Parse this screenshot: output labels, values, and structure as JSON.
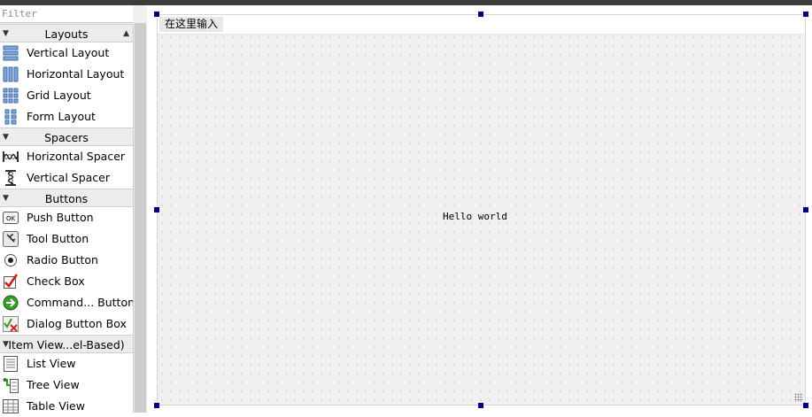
{
  "widget_box": {
    "filter_placeholder": "Filter",
    "categories": [
      {
        "title": "Layouts",
        "items": [
          {
            "label": "Vertical Layout",
            "icon": "vertical-layout-icon"
          },
          {
            "label": "Horizontal Layout",
            "icon": "horizontal-layout-icon"
          },
          {
            "label": "Grid Layout",
            "icon": "grid-layout-icon"
          },
          {
            "label": "Form Layout",
            "icon": "form-layout-icon"
          }
        ]
      },
      {
        "title": "Spacers",
        "items": [
          {
            "label": "Horizontal Spacer",
            "icon": "horizontal-spacer-icon"
          },
          {
            "label": "Vertical Spacer",
            "icon": "vertical-spacer-icon"
          }
        ]
      },
      {
        "title": "Buttons",
        "items": [
          {
            "label": "Push Button",
            "icon": "push-button-icon",
            "icon_text": "OK"
          },
          {
            "label": "Tool Button",
            "icon": "tool-button-icon"
          },
          {
            "label": "Radio Button",
            "icon": "radio-button-icon"
          },
          {
            "label": "Check Box",
            "icon": "check-box-icon"
          },
          {
            "label": "Command... Button",
            "icon": "command-link-button-icon"
          },
          {
            "label": "Dialog Button Box",
            "icon": "dialog-button-box-icon"
          }
        ]
      },
      {
        "title": "Item View...el-Based)",
        "items": [
          {
            "label": "List View",
            "icon": "list-view-icon"
          },
          {
            "label": "Tree View",
            "icon": "tree-view-icon"
          },
          {
            "label": "Table View",
            "icon": "table-view-icon"
          }
        ]
      }
    ]
  },
  "form": {
    "menu_placeholder": "在这里输入",
    "label_text": "Hello world"
  },
  "colors": {
    "handle": "#00007f",
    "form_background": "#f0f0f0",
    "accent_green": "#3a9a2a",
    "accent_red": "#d02020"
  }
}
